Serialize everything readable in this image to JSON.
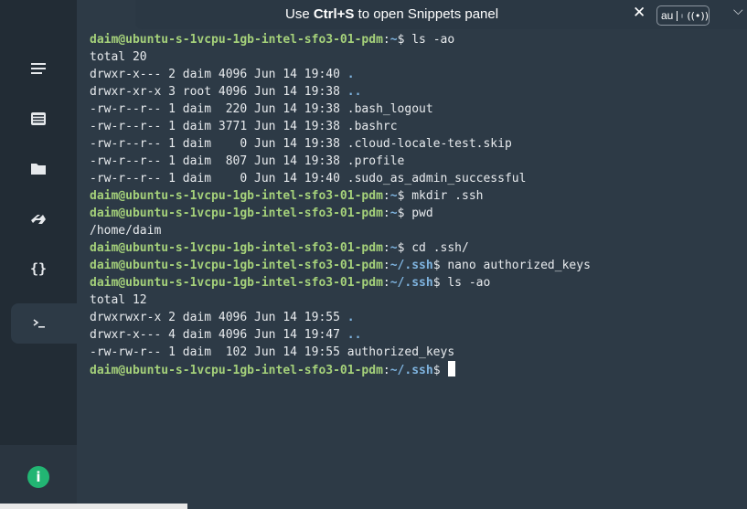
{
  "banner": {
    "prefix": "Use ",
    "shortcut": "Ctrl+S",
    "suffix": " to open Snippets panel",
    "close_glyph": "✕",
    "badge_text": "au",
    "badge_radio": "((•))",
    "chevron": "⌵"
  },
  "sidebar": {
    "icons": [
      "menu-icon",
      "hosts-icon",
      "folder-icon",
      "port-forward-icon",
      "snippets-icon",
      "terminal-icon"
    ],
    "snippets_glyph": "{}",
    "info_glyph": "i"
  },
  "terminal": {
    "lines": [
      {
        "user": "daim@ubuntu-s-1vcpu-1gb-intel-sfo3-01-pdm",
        "path": "~",
        "cmd": " ls -ao"
      },
      {
        "text": "total 20"
      },
      {
        "text": "drwxr-x--- 2 daim 4096 Jun 14 19:40 ",
        "dir": "."
      },
      {
        "text": "drwxr-xr-x 3 root 4096 Jun 14 19:38 ",
        "dir": ".."
      },
      {
        "text": "-rw-r--r-- 1 daim  220 Jun 14 19:38 .bash_logout"
      },
      {
        "text": "-rw-r--r-- 1 daim 3771 Jun 14 19:38 .bashrc"
      },
      {
        "text": "-rw-r--r-- 1 daim    0 Jun 14 19:38 .cloud-locale-test.skip"
      },
      {
        "text": "-rw-r--r-- 1 daim  807 Jun 14 19:38 .profile"
      },
      {
        "text": "-rw-r--r-- 1 daim    0 Jun 14 19:40 .sudo_as_admin_successful"
      },
      {
        "user": "daim@ubuntu-s-1vcpu-1gb-intel-sfo3-01-pdm",
        "path": "~",
        "cmd": " mkdir .ssh"
      },
      {
        "user": "daim@ubuntu-s-1vcpu-1gb-intel-sfo3-01-pdm",
        "path": "~",
        "cmd": " pwd"
      },
      {
        "text": "/home/daim"
      },
      {
        "user": "daim@ubuntu-s-1vcpu-1gb-intel-sfo3-01-pdm",
        "path": "~",
        "cmd": " cd .ssh/"
      },
      {
        "user": "daim@ubuntu-s-1vcpu-1gb-intel-sfo3-01-pdm",
        "path": "~/.ssh",
        "cmd": " nano authorized_keys"
      },
      {
        "user": "daim@ubuntu-s-1vcpu-1gb-intel-sfo3-01-pdm",
        "path": "~/.ssh",
        "cmd": " ls -ao"
      },
      {
        "text": "total 12"
      },
      {
        "text": "drwxrwxr-x 2 daim 4096 Jun 14 19:55 ",
        "dir": "."
      },
      {
        "text": "drwxr-x--- 4 daim 4096 Jun 14 19:47 ",
        "dir": ".."
      },
      {
        "text": "-rw-rw-r-- 1 daim  102 Jun 14 19:55 authorized_keys"
      },
      {
        "user": "daim@ubuntu-s-1vcpu-1gb-intel-sfo3-01-pdm",
        "path": "~/.ssh",
        "cmd": " ",
        "cursor": true
      }
    ]
  }
}
